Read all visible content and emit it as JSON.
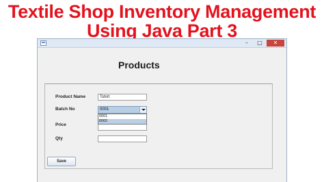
{
  "headline": {
    "line1": "Textile Shop Inventory Management",
    "line2": "Using Java Part 3"
  },
  "window": {
    "controls": {
      "minimize": "–",
      "maximize": "□",
      "close": "✕"
    },
    "icon": "java-app-icon"
  },
  "form": {
    "title": "Products",
    "product_name": {
      "label": "Product Name",
      "value": "Tshirt"
    },
    "batch_no": {
      "label": "Batch No",
      "selected": "0001",
      "options": [
        "0001",
        "0002"
      ],
      "highlighted_option": "0002"
    },
    "price": {
      "label": "Price",
      "value": ""
    },
    "qty": {
      "label": "Qty",
      "value": ""
    },
    "save_label": "Save"
  },
  "colors": {
    "headline": "#e3121d",
    "window_bg": "#f0f0f0",
    "selection": "#b8cfe6"
  }
}
